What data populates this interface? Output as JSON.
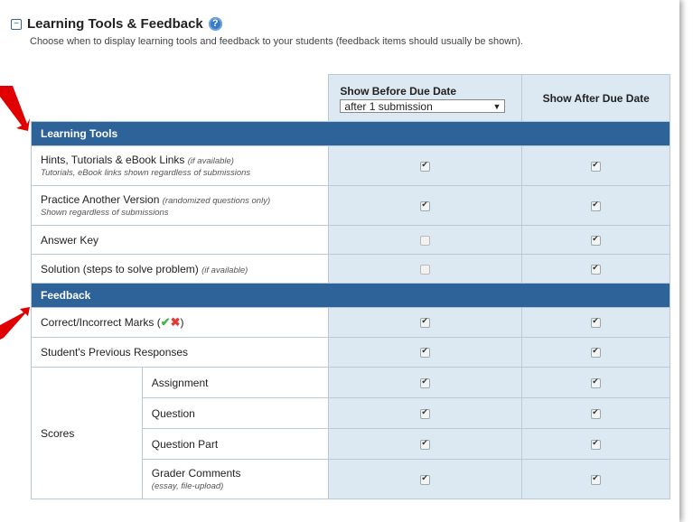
{
  "section": {
    "title": "Learning Tools & Feedback",
    "help_glyph": "?",
    "description": "Choose when to display learning tools and feedback to your students (feedback items should usually be shown)."
  },
  "columns": {
    "before_label": "Show Before Due Date",
    "before_select_value": "after 1 submission",
    "after_label": "Show After Due Date"
  },
  "learning_tools": {
    "heading": "Learning Tools",
    "rows": [
      {
        "label": "Hints, Tutorials & eBook Links",
        "qualifier": "(if available)",
        "note": "Tutorials, eBook links shown regardless of submissions",
        "before": true,
        "after": true
      },
      {
        "label": "Practice Another Version",
        "qualifier": "(randomized questions only)",
        "note": "Shown regardless of submissions",
        "before": true,
        "after": true
      },
      {
        "label": "Answer Key",
        "qualifier": "",
        "note": "",
        "before": false,
        "after": true
      },
      {
        "label": "Solution (steps to solve problem)",
        "qualifier": "(if available)",
        "note": "",
        "before": false,
        "after": true
      }
    ]
  },
  "feedback": {
    "heading": "Feedback",
    "marks_label_pre": "Correct/Incorrect Marks (",
    "marks_label_post": ")",
    "previous_responses_label": "Student's Previous Responses",
    "scores_label": "Scores",
    "scores": [
      {
        "label": "Assignment",
        "note": ""
      },
      {
        "label": "Question",
        "note": ""
      },
      {
        "label": "Question Part",
        "note": ""
      },
      {
        "label": "Grader Comments",
        "note": "(essay, file-upload)"
      }
    ]
  },
  "colors": {
    "section_header_bg": "#2e6399",
    "check_column_bg": "#dce8f2",
    "arrow": "#e00000"
  }
}
